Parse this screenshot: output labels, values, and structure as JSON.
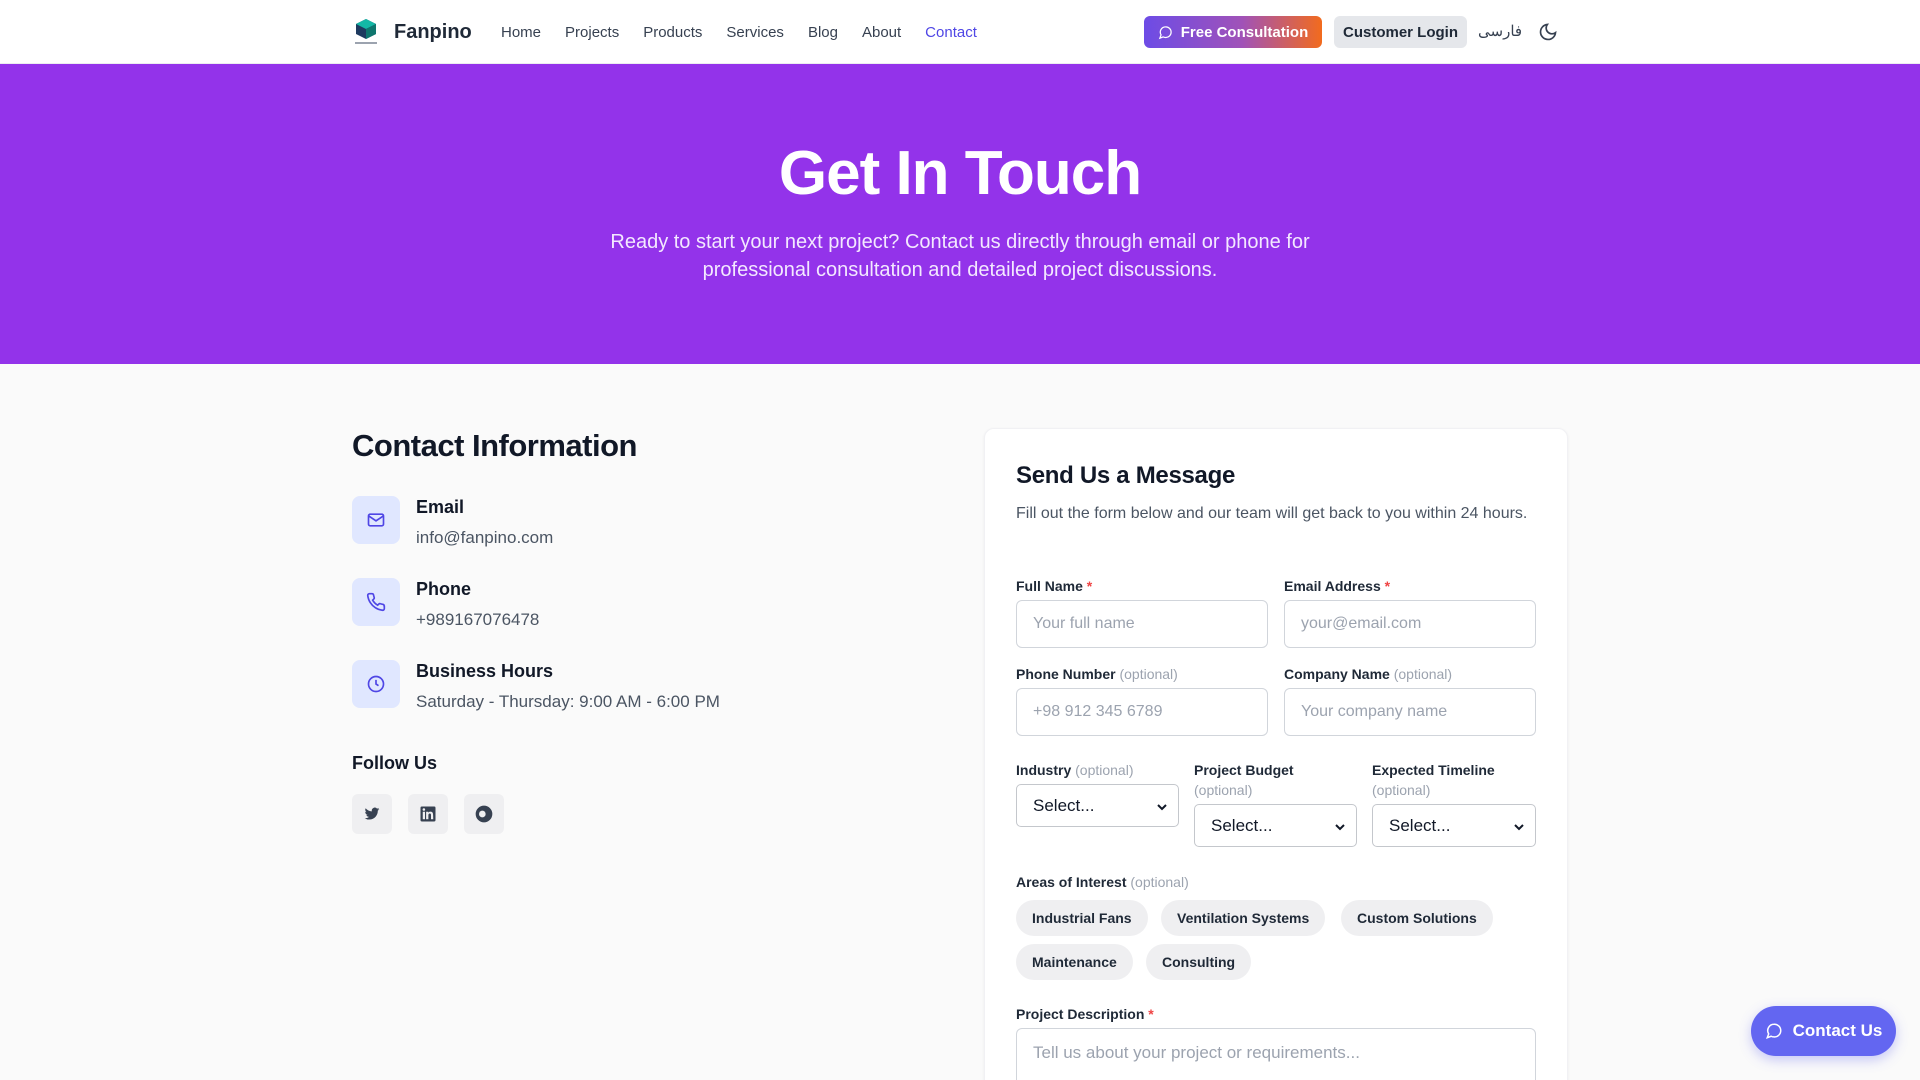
{
  "header": {
    "brand": "Fanpino",
    "nav": [
      {
        "label": "Home"
      },
      {
        "label": "Projects"
      },
      {
        "label": "Products"
      },
      {
        "label": "Services"
      },
      {
        "label": "Blog"
      },
      {
        "label": "About"
      },
      {
        "label": "Contact",
        "active": true
      }
    ],
    "consult_label": "Free Consultation",
    "login_label": "Customer Login",
    "language_label": "فارسی"
  },
  "hero": {
    "title": "Get In Touch",
    "subtitle": "Ready to start your next project? Contact us directly through email or phone for professional consultation and detailed project discussions."
  },
  "contact_info": {
    "title": "Contact Information",
    "items": [
      {
        "label": "Email",
        "value": "info@fanpino.com",
        "icon": "mail-icon"
      },
      {
        "label": "Phone",
        "value": "+989167076478",
        "icon": "phone-icon"
      },
      {
        "label": "Business Hours",
        "value": "Saturday - Thursday: 9:00 AM - 6:00 PM",
        "icon": "clock-icon"
      }
    ],
    "follow_label": "Follow Us",
    "social": [
      "twitter-icon",
      "linkedin-icon",
      "circle-icon"
    ]
  },
  "form": {
    "title": "Send Us a Message",
    "subtitle": "Fill out the form below and our team will get back to you within 24 hours.",
    "optional_text": "(optional)",
    "required_mark": "*",
    "full_name": {
      "label": "Full Name",
      "placeholder": "Your full name"
    },
    "email": {
      "label": "Email Address",
      "placeholder": "your@email.com"
    },
    "phone": {
      "label": "Phone Number",
      "placeholder": "+98 912 345 6789"
    },
    "company": {
      "label": "Company Name",
      "placeholder": "Your company name"
    },
    "industry": {
      "label": "Industry",
      "value": "Select..."
    },
    "budget": {
      "label": "Project Budget",
      "value": "Select..."
    },
    "timeline": {
      "label": "Expected Timeline",
      "value": "Select..."
    },
    "interests_label": "Areas of Interest",
    "interests": [
      "Industrial Fans",
      "Ventilation Systems",
      "Custom Solutions",
      "Maintenance",
      "Consulting"
    ],
    "description": {
      "label": "Project Description",
      "placeholder": "Tell us about your project or requirements..."
    }
  },
  "float_button": {
    "label": "Contact Us"
  },
  "colors": {
    "hero_bg": "#9333ea",
    "accent": "#4f46e5",
    "float_btn": "#6366f1"
  }
}
